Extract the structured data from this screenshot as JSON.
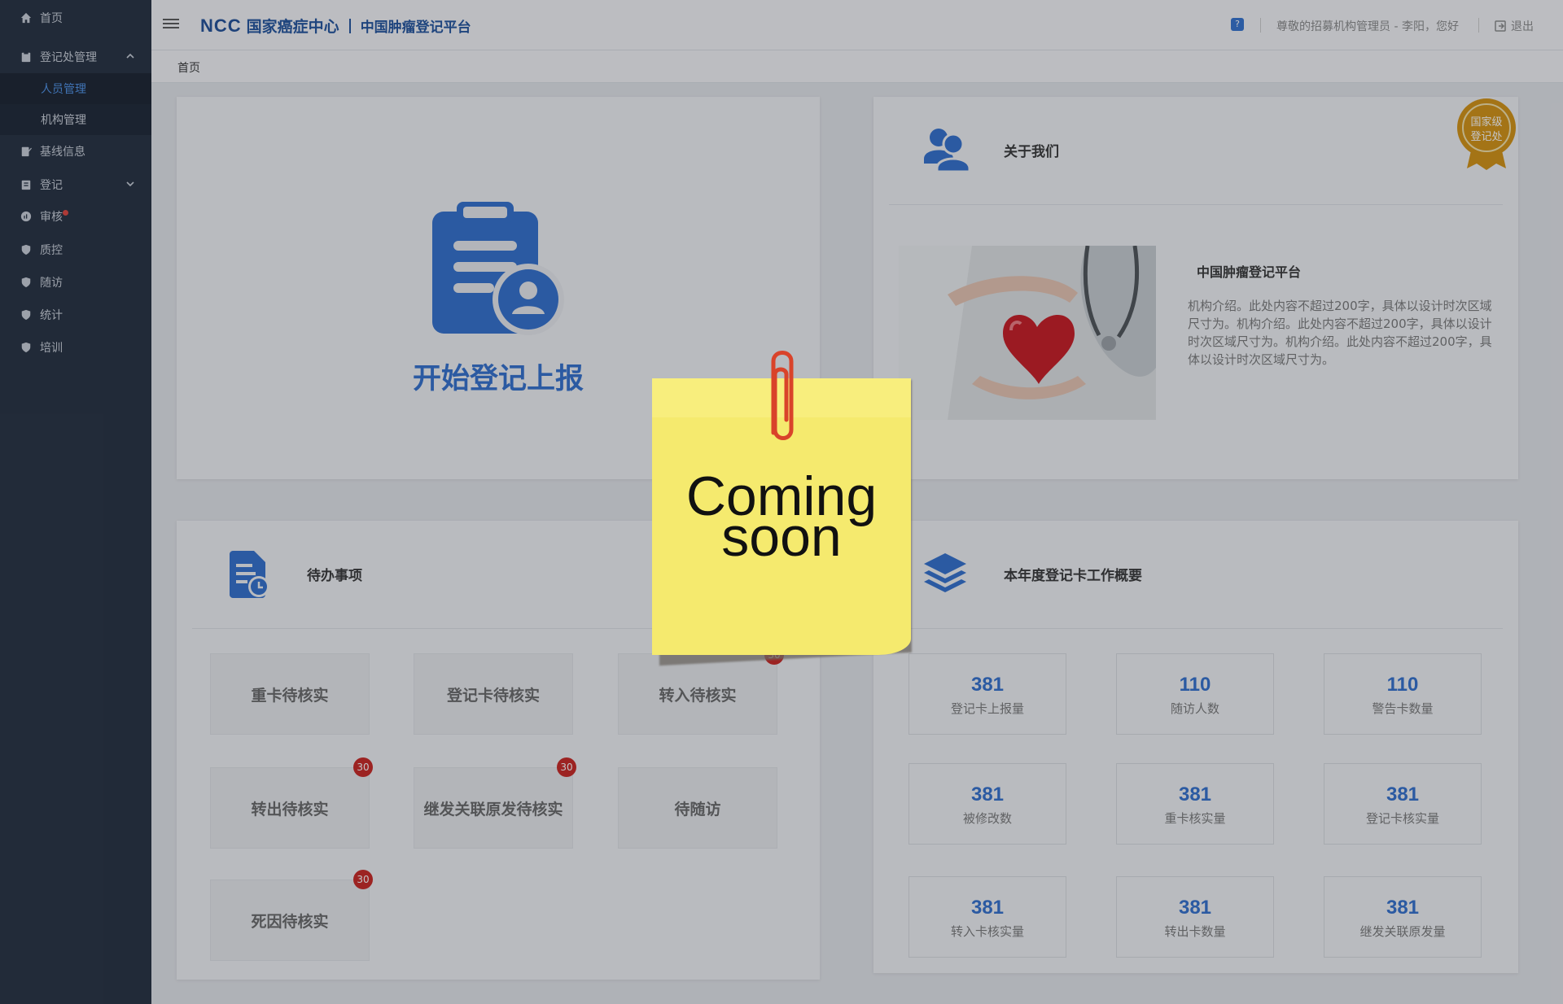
{
  "sidebar": {
    "items": [
      {
        "label": "首页"
      },
      {
        "label": "登记处管理"
      },
      {
        "label": "基线信息"
      },
      {
        "label": "登记"
      },
      {
        "label": "审核"
      },
      {
        "label": "质控"
      },
      {
        "label": "随访"
      },
      {
        "label": "统计"
      },
      {
        "label": "培训"
      }
    ],
    "sub_items": [
      {
        "label": "人员管理",
        "active": true
      },
      {
        "label": "机构管理",
        "active": false
      }
    ]
  },
  "header": {
    "logo_ncc": "NCC",
    "logo_cn": "国家癌症中心",
    "platform": "中国肿瘤登记平台",
    "help_icon": "?",
    "greeting": "尊敬的招募机构管理员 - 李阳，您好",
    "logout": "退出"
  },
  "breadcrumb": "首页",
  "start": {
    "label": "开始登记上报",
    "icon": "clipboard-user-icon"
  },
  "about": {
    "title": "关于我们",
    "badge_line1": "国家级",
    "badge_line2": "登记处",
    "subtitle": "中国肿瘤登记平台",
    "description": "机构介绍。此处内容不超过200字，具体以设计时次区域尺寸为。机构介绍。此处内容不超过200字，具体以设计时次区域尺寸为。机构介绍。此处内容不超过200字，具体以设计时次区域尺寸为。"
  },
  "todo": {
    "title": "待办事项",
    "items": [
      {
        "label": "重卡待核实",
        "badge": ""
      },
      {
        "label": "登记卡待核实",
        "badge": ""
      },
      {
        "label": "转入待核实",
        "badge": "30"
      },
      {
        "label": "转出待核实",
        "badge": "30"
      },
      {
        "label": "继发关联原发待核实",
        "badge": "30"
      },
      {
        "label": "待随访",
        "badge": ""
      },
      {
        "label": "死因待核实",
        "badge": "30"
      }
    ]
  },
  "stats": {
    "title": "本年度登记卡工作概要",
    "items": [
      {
        "value": "381",
        "label": "登记卡上报量"
      },
      {
        "value": "110",
        "label": "随访人数"
      },
      {
        "value": "110",
        "label": "警告卡数量"
      },
      {
        "value": "381",
        "label": "被修改数"
      },
      {
        "value": "381",
        "label": "重卡核实量"
      },
      {
        "value": "381",
        "label": "登记卡核实量"
      },
      {
        "value": "381",
        "label": "转入卡核实量"
      },
      {
        "value": "381",
        "label": "转出卡数量"
      },
      {
        "value": "381",
        "label": "继发关联原发量"
      }
    ]
  },
  "note": {
    "line1": "Coming",
    "line2": "soon"
  },
  "colors": {
    "sidebar_bg": "#1f2a3b",
    "accent_blue": "#2d6ccd",
    "badge_red": "#c9201c",
    "note_yellow": "#f5ea6e",
    "gold": "#d4900c"
  }
}
